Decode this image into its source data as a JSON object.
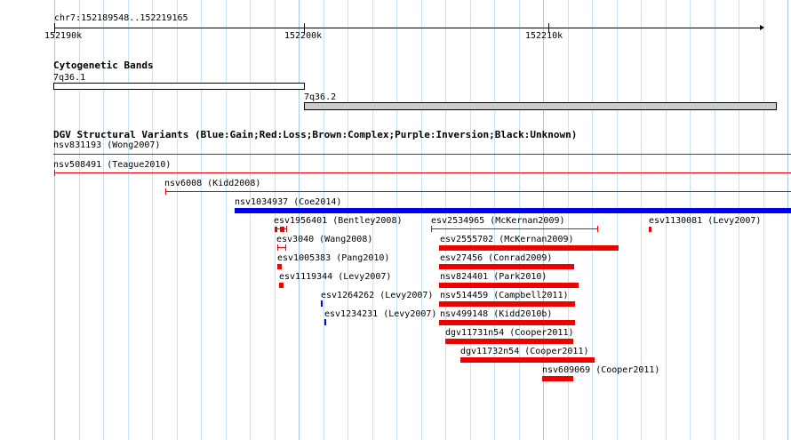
{
  "ruler": {
    "location": "chr7:152189548..152219165",
    "ticks": [
      "152190k",
      "152200k",
      "152210k"
    ]
  },
  "colors": {
    "gain": "#0000ee",
    "loss": "#ee0000",
    "grid": "#c6e4ef",
    "band_dark": "#cccccc"
  },
  "tracks": {
    "cytoband": {
      "title": "Cytogenetic Bands",
      "bands": [
        {
          "name": "7q36.1",
          "stain": "light"
        },
        {
          "name": "7q36.2",
          "stain": "gray"
        }
      ]
    },
    "dgv": {
      "title": "DGV Structural Variants (Blue:Gain;Red:Loss;Brown:Complex;Purple:Inversion;Black:Unknown)",
      "features": [
        {
          "id": "f0",
          "label": "nsv831193 (Wong2007)",
          "type": "loss",
          "style": "line"
        },
        {
          "id": "f1",
          "label": "nsv508491 (Teague2010)",
          "type": "loss",
          "style": "line"
        },
        {
          "id": "f2",
          "label": "nsv6008 (Kidd2008)",
          "type": "loss",
          "style": "line"
        },
        {
          "id": "f3",
          "label": "nsv1034937 (Coe2014)",
          "type": "gain",
          "style": "bar"
        },
        {
          "id": "f4",
          "label": "esv1956401 (Bentley2008)",
          "type": "loss",
          "style": "split"
        },
        {
          "id": "f5",
          "label": "esv2534965 (McKernan2009)",
          "type": "loss",
          "style": "line"
        },
        {
          "id": "f6",
          "label": "esv1130081 (Levy2007)",
          "type": "loss",
          "style": "bar"
        },
        {
          "id": "f7",
          "label": "esv3040 (Wang2008)",
          "type": "loss",
          "style": "line"
        },
        {
          "id": "f8",
          "label": "esv2555702 (McKernan2009)",
          "type": "loss",
          "style": "bar"
        },
        {
          "id": "f9",
          "label": "esv1005383 (Pang2010)",
          "type": "loss",
          "style": "bar"
        },
        {
          "id": "f10",
          "label": "esv27456 (Conrad2009)",
          "type": "loss",
          "style": "bar"
        },
        {
          "id": "f11",
          "label": "esv1119344 (Levy2007)",
          "type": "loss",
          "style": "bar"
        },
        {
          "id": "f12",
          "label": "nsv824401 (Park2010)",
          "type": "loss",
          "style": "bar"
        },
        {
          "id": "f13",
          "label": "esv1264262 (Levy2007)",
          "type": "gain",
          "style": "bar"
        },
        {
          "id": "f14",
          "label": "nsv514459 (Campbell2011)",
          "type": "loss",
          "style": "bar"
        },
        {
          "id": "f15",
          "label": "esv1234231 (Levy2007)",
          "type": "gain",
          "style": "bar"
        },
        {
          "id": "f16",
          "label": "nsv499148 (Kidd2010b)",
          "type": "loss",
          "style": "bar"
        },
        {
          "id": "f17",
          "label": "dgv11731n54 (Cooper2011)",
          "type": "loss",
          "style": "bar"
        },
        {
          "id": "f18",
          "label": "dgv11732n54 (Cooper2011)",
          "type": "loss",
          "style": "bar"
        },
        {
          "id": "f19",
          "label": "nsv609069 (Cooper2011)",
          "type": "loss",
          "style": "bar"
        }
      ]
    }
  }
}
